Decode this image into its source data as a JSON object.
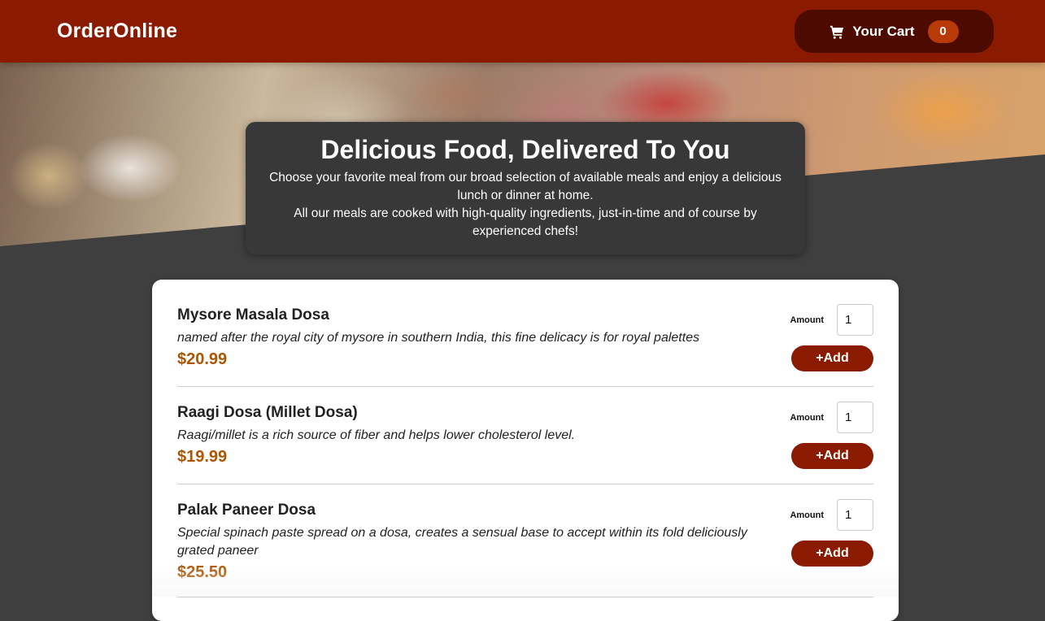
{
  "header": {
    "logo": "OrderOnline",
    "cart_label": "Your Cart",
    "cart_count": "0",
    "colors": {
      "primary": "#8a1a00",
      "cart_bg": "#4d0b00",
      "badge": "#b83a09"
    }
  },
  "hero": {
    "title": "Delicious Food, Delivered To You",
    "line1": "Choose your favorite meal from our broad selection of available meals and enjoy a delicious lunch or dinner at home.",
    "line2": "All our meals are cooked with high-quality ingredients, just-in-time and of course by experienced chefs!"
  },
  "meals": [
    {
      "name": "Mysore Masala Dosa",
      "description": "named after the royal city of mysore in southern India, this fine delicacy is for royal palettes",
      "price": "$20.99",
      "amount_label": "Amount",
      "amount": "1",
      "add_label": "+Add"
    },
    {
      "name": "Raagi Dosa (Millet Dosa)",
      "description": "Raagi/millet is a rich source of fiber and helps lower cholesterol level.",
      "price": "$19.99",
      "amount_label": "Amount",
      "amount": "1",
      "add_label": "+Add"
    },
    {
      "name": "Palak Paneer Dosa",
      "description": "Special spinach paste spread on a dosa, creates a sensual base to accept within its fold deliciously grated paneer",
      "price": "$25.50",
      "amount_label": "Amount",
      "amount": "1",
      "add_label": "+Add"
    }
  ]
}
